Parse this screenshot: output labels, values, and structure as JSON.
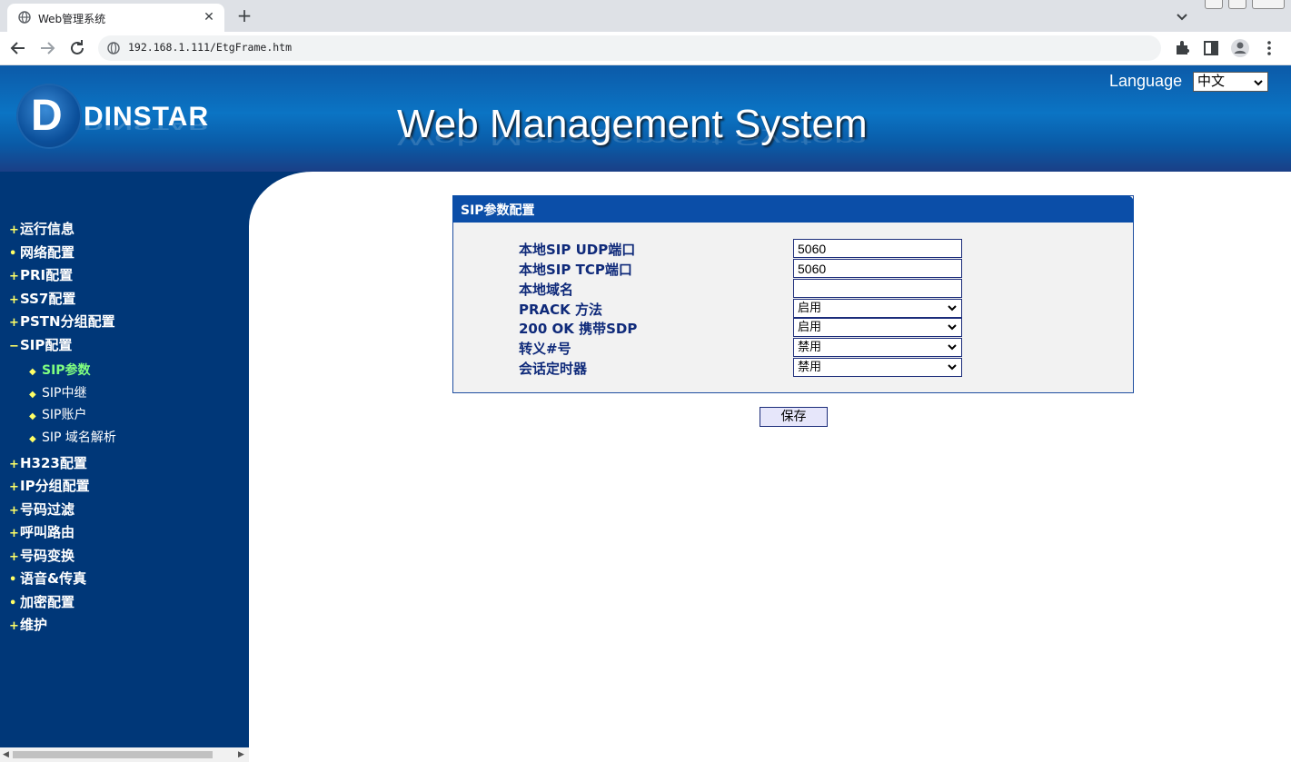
{
  "browser": {
    "tab_title": "Web管理系统",
    "tab_close": "✕",
    "new_tab": "+",
    "url": "192.168.1.111/EtgFrame.htm"
  },
  "header": {
    "logo_mark": "D",
    "logo_text": "DINSTAR",
    "title": "Web Management System",
    "language_label": "Language",
    "language_value": "中文"
  },
  "sidebar": {
    "items": [
      {
        "bullet": "+",
        "label": "运行信息"
      },
      {
        "bullet": "•",
        "label": "网络配置"
      },
      {
        "bullet": "+",
        "label": "PRI配置"
      },
      {
        "bullet": "+",
        "label": "SS7配置"
      },
      {
        "bullet": "+",
        "label": "PSTN分组配置"
      },
      {
        "bullet": "−",
        "label": "SIP配置"
      }
    ],
    "sub_items": [
      {
        "bullet": "◆",
        "label": "SIP参数"
      },
      {
        "bullet": "◆",
        "label": "SIP中继"
      },
      {
        "bullet": "◆",
        "label": "SIP账户"
      },
      {
        "bullet": "◆",
        "label": "SIP 域名解析"
      }
    ],
    "items_after": [
      {
        "bullet": "+",
        "label": "H323配置"
      },
      {
        "bullet": "+",
        "label": "IP分组配置"
      },
      {
        "bullet": "+",
        "label": "号码过滤"
      },
      {
        "bullet": "+",
        "label": "呼叫路由"
      },
      {
        "bullet": "+",
        "label": "号码变换"
      },
      {
        "bullet": "•",
        "label": "语音&传真"
      },
      {
        "bullet": "•",
        "label": "加密配置"
      },
      {
        "bullet": "+",
        "label": "维护"
      }
    ]
  },
  "panel": {
    "title": "SIP参数配置",
    "rows": [
      {
        "label": "本地SIP UDP端口",
        "value": "5060"
      },
      {
        "label": "本地SIP TCP端口",
        "value": "5060"
      },
      {
        "label": "本地域名",
        "value": ""
      },
      {
        "label": "PRACK 方法",
        "value": "启用"
      },
      {
        "label": "200 OK 携带SDP",
        "value": "启用"
      },
      {
        "label": "转义#号",
        "value": "禁用"
      },
      {
        "label": "会话定时器",
        "value": "禁用"
      }
    ],
    "save_label": "保存"
  },
  "colors": {
    "sidebar_bg": "#003778",
    "banner": "#0b74c4",
    "panel_header": "#0b4ea8",
    "active_sub": "#80ff80"
  }
}
